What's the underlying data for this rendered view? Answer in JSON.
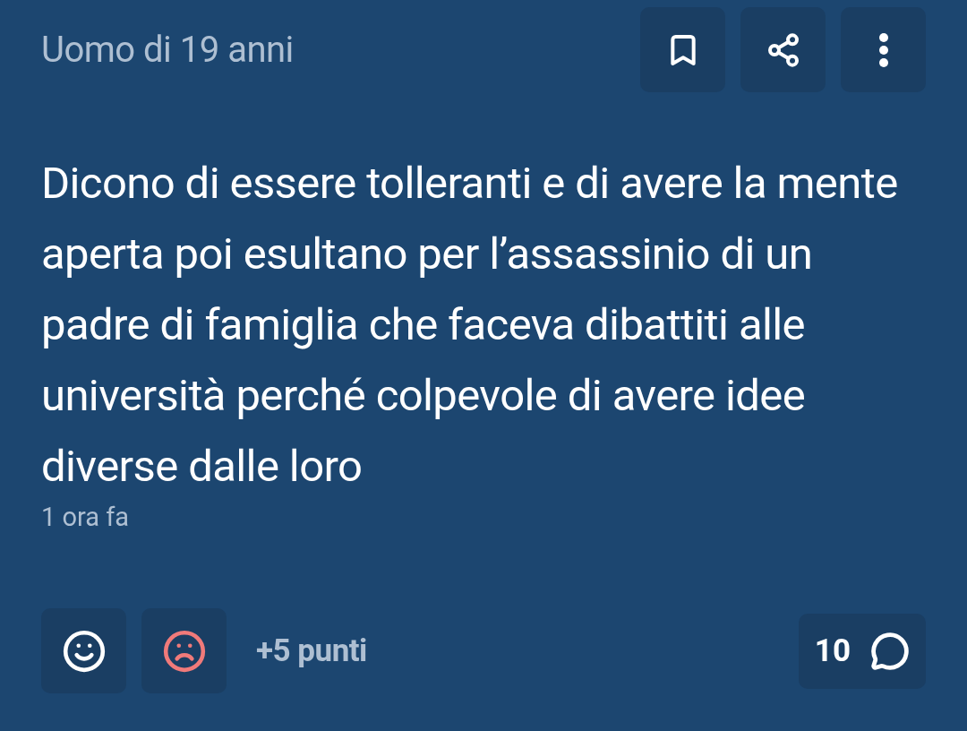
{
  "author": "Uomo di 19 anni",
  "actions": [
    {
      "kind": "bookmark"
    },
    {
      "kind": "share"
    },
    {
      "kind": "more"
    }
  ],
  "body": "Dicono di essere tolleranti e di avere la mente aperta poi esultano per l’assassinio di un padre di famiglia che faceva dibattiti alle università perché colpevole di avere idee diverse dalle loro",
  "time": "1 ora fa",
  "votes": [
    {
      "kind": "up"
    },
    {
      "kind": "down"
    }
  ],
  "points": "+5 punti",
  "comments": "10"
}
